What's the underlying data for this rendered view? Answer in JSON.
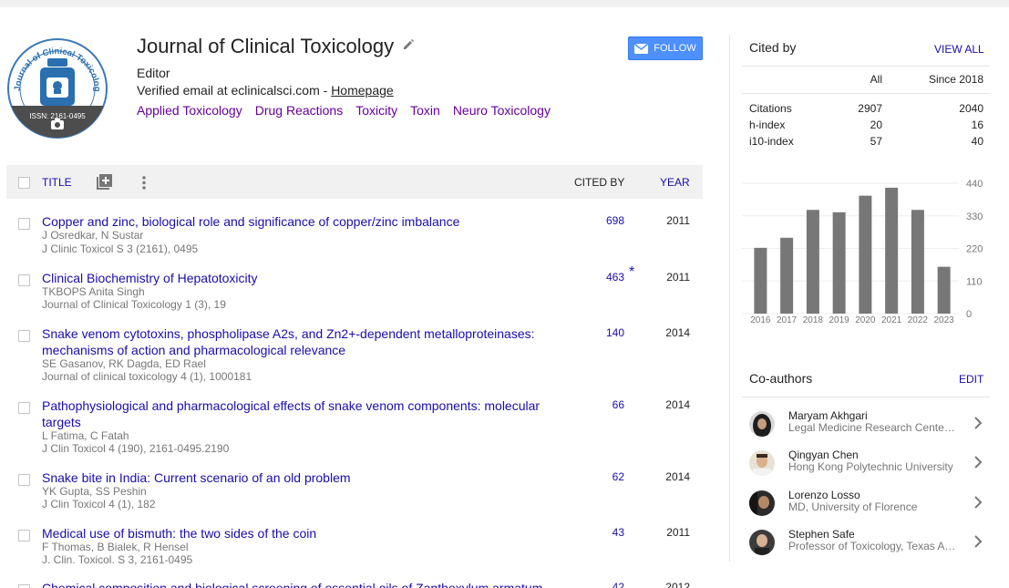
{
  "profile": {
    "name": "Journal of Clinical Toxicology",
    "affiliation": "Editor",
    "email_text": "Verified email at eclinicalsci.com - ",
    "homepage_label": "Homepage",
    "logo_text": "Journal of Clinical Toxicology",
    "logo_issn": "ISSN: 2161-0495",
    "interests": [
      "Applied Toxicology",
      "Drug Reactions",
      "Toxicity",
      "Toxin",
      "Neuro Toxicology"
    ],
    "follow_label": "FOLLOW"
  },
  "table": {
    "headers": {
      "title": "TITLE",
      "cited_by": "CITED BY",
      "year": "YEAR"
    },
    "rows": [
      {
        "title": "Copper and zinc, biological role and significance of copper/zinc imbalance",
        "authors": "J Osredkar, N Sustar",
        "venue": "J Clinic Toxicol S 3 (2161), 0495",
        "cited": "698",
        "star": "",
        "year": "2011"
      },
      {
        "title": "Clinical Biochemistry of Hepatotoxicity",
        "authors": "TKBOPS Anita Singh",
        "venue": "Journal of Clinical Toxicology 1 (3), 19",
        "cited": "463",
        "star": "*",
        "year": "2011"
      },
      {
        "title": "Snake venom cytotoxins, phospholipase A2s, and Zn2+-dependent metalloproteinases: mechanisms of action and pharmacological relevance",
        "authors": "SE Gasanov, RK Dagda, ED Rael",
        "venue": "Journal of clinical toxicology 4 (1), 1000181",
        "cited": "140",
        "star": "",
        "year": "2014"
      },
      {
        "title": "Pathophysiological and pharmacological effects of snake venom components: molecular targets",
        "authors": "L Fatima, C Fatah",
        "venue": "J Clin Toxicol 4 (190), 2161-0495.2190",
        "cited": "66",
        "star": "",
        "year": "2014"
      },
      {
        "title": "Snake bite in India: Current scenario of an old problem",
        "authors": "YK Gupta, SS Peshin",
        "venue": "J Clin Toxicol 4 (1), 182",
        "cited": "62",
        "star": "",
        "year": "2014"
      },
      {
        "title": "Medical use of bismuth: the two sides of the coin",
        "authors": "F Thomas, B Bialek, R Hensel",
        "venue": "J. Clin. Toxicol. S 3, 2161-0495",
        "cited": "43",
        "star": "",
        "year": "2011"
      },
      {
        "title": "Chemical composition and biological screening of essential oils of Zanthoxylum armatum",
        "authors": "",
        "venue": "",
        "cited": "42",
        "star": "",
        "year": "2012"
      }
    ]
  },
  "cited_by": {
    "title": "Cited by",
    "view_all": "VIEW ALL",
    "col_all": "All",
    "col_since": "Since 2018",
    "stats": [
      {
        "label": "Citations",
        "all": "2907",
        "since": "2040"
      },
      {
        "label": "h-index",
        "all": "20",
        "since": "16"
      },
      {
        "label": "i10-index",
        "all": "57",
        "since": "40"
      }
    ]
  },
  "chart_data": {
    "type": "bar",
    "categories": [
      "2016",
      "2017",
      "2018",
      "2019",
      "2020",
      "2021",
      "2022",
      "2023"
    ],
    "values": [
      222,
      256,
      350,
      342,
      398,
      425,
      350,
      158
    ],
    "yticks": [
      0,
      110,
      220,
      330,
      440
    ],
    "ylim": [
      0,
      440
    ],
    "color": "#777777"
  },
  "coauthors": {
    "title": "Co-authors",
    "edit_label": "EDIT",
    "items": [
      {
        "name": "Maryam Akhgari",
        "affiliation": "Legal Medicine Research Center, Legal Medicine Organization, Tehran, Iran"
      },
      {
        "name": "Qingyan Chen",
        "affiliation": "Hong Kong Polytechnic University"
      },
      {
        "name": "Lorenzo Losso",
        "affiliation": "MD, University of Florence"
      },
      {
        "name": "Stephen Safe",
        "affiliation": "Professor of Toxicology, Texas A&M University"
      }
    ]
  },
  "colors": {
    "link": "#1a0dab",
    "interest": "#660099",
    "follow": "#4d90fe"
  }
}
